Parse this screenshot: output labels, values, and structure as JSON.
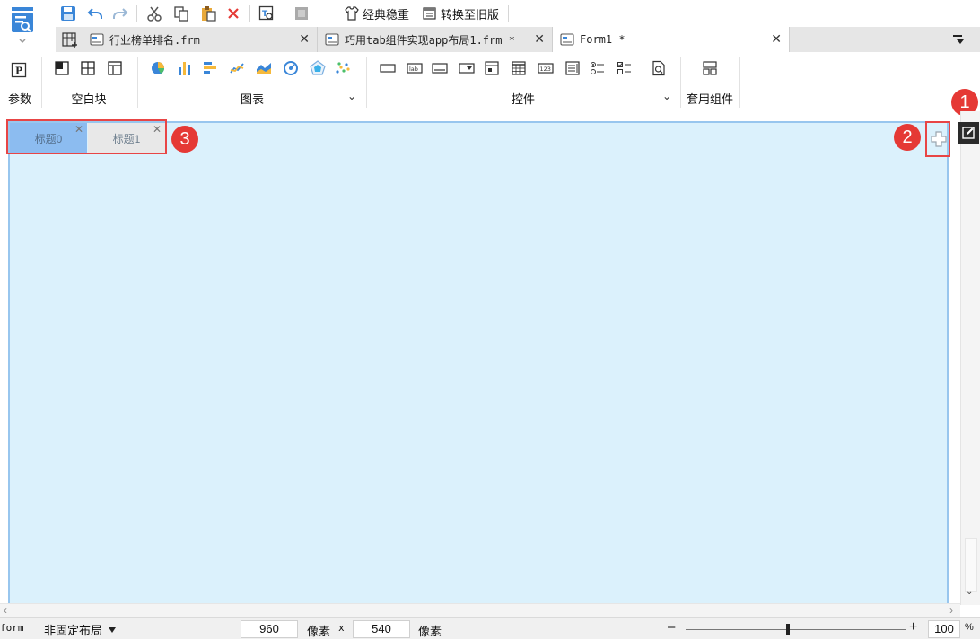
{
  "quickbar": {
    "classic_label": "经典稳重",
    "convert_label": "转换至旧版"
  },
  "tabs": [
    {
      "label": "行业榜单排名.frm"
    },
    {
      "label": "巧用tab组件实现app布局1.frm *"
    },
    {
      "label": "Form1 *"
    }
  ],
  "ribbon": {
    "param_icon_letter": "P",
    "param_label": "参数",
    "blank_label": "空白块",
    "chart_label": "图表",
    "control_label": "控件",
    "template_label": "套用组件"
  },
  "widget_tabs": [
    {
      "label": "标题0"
    },
    {
      "label": "标题1"
    }
  ],
  "badges": [
    "1",
    "2",
    "3"
  ],
  "statusbar": {
    "type_label": "form",
    "layout_label": "非固定布局",
    "width_value": "960",
    "unit1": "像素",
    "times": "x",
    "height_value": "540",
    "unit2": "像素",
    "zoom_value": "100",
    "zoom_unit": "%"
  },
  "colors": {
    "canvas_bg": "#dbf1fc",
    "active_widget_tab": "#8cbcf0",
    "highlight_red": "#e84545",
    "brand_blue": "#3a86d8"
  }
}
